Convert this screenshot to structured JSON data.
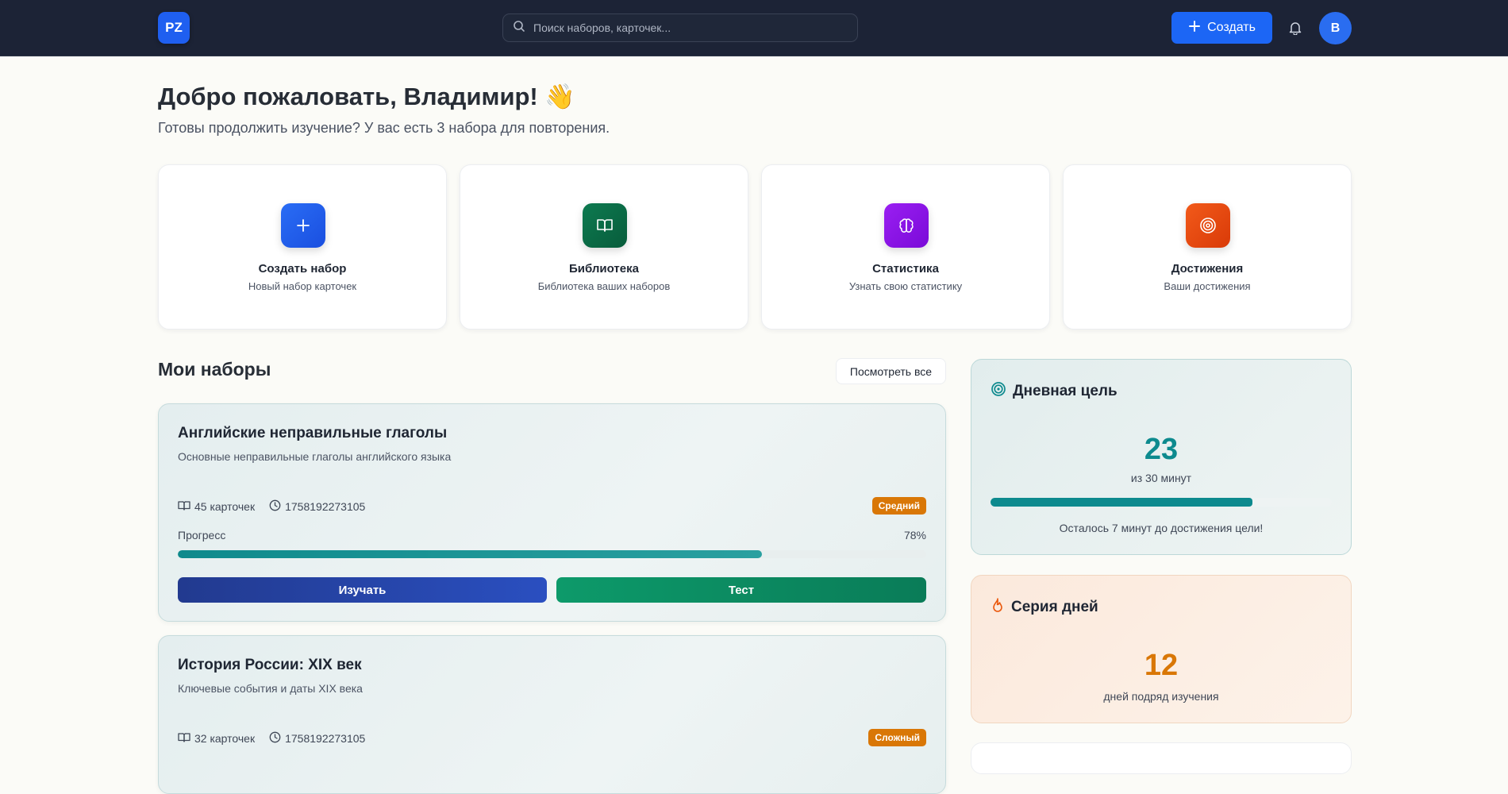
{
  "header": {
    "logo": "PZ",
    "search_placeholder": "Поиск наборов, карточек...",
    "create_label": "Создать",
    "avatar_initial": "В"
  },
  "welcome": {
    "title": "Добро пожаловать, Владимир! 👋",
    "subtitle": "Готовы продолжить изучение? У вас есть 3 набора для повторения."
  },
  "quick_actions": [
    {
      "title": "Создать набор",
      "subtitle": "Новый набор карточек",
      "icon": "plus-icon",
      "color": "#1f5ff0"
    },
    {
      "title": "Библиотека",
      "subtitle": "Библиотека ваших наборов",
      "icon": "book-icon",
      "color": "#0b6b45"
    },
    {
      "title": "Статистика",
      "subtitle": "Узнать свою статистику",
      "icon": "brain-icon",
      "color": "#8a12e8"
    },
    {
      "title": "Достижения",
      "subtitle": "Ваши достижения",
      "icon": "target-icon",
      "color": "#ea4a0c"
    }
  ],
  "my_sets": {
    "title": "Мои наборы",
    "view_all": "Посмотреть все",
    "sets": [
      {
        "title": "Английские неправильные глаголы",
        "description": "Основные неправильные глаголы английского языка",
        "cards": "45 карточек",
        "timestamp": "1758192273105",
        "level": "Средний",
        "level_color": "#d97706",
        "progress_label": "Прогресс",
        "progress_text": "78%",
        "progress_fraction": 0.78,
        "study_label": "Изучать",
        "test_label": "Тест"
      },
      {
        "title": "История России: XIX век",
        "description": "Ключевые события и даты XIX века",
        "cards": "32 карточек",
        "timestamp": "1758192273105",
        "level": "Сложный",
        "level_color": "#d97706"
      }
    ]
  },
  "daily_goal": {
    "title": "Дневная цель",
    "value": "23",
    "sub": "из 30 минут",
    "progress_fraction": 0.7667,
    "note": "Осталось 7 минут до достижения цели!"
  },
  "streak": {
    "title": "Серия дней",
    "value": "12",
    "sub": "дней подряд изучения"
  }
}
